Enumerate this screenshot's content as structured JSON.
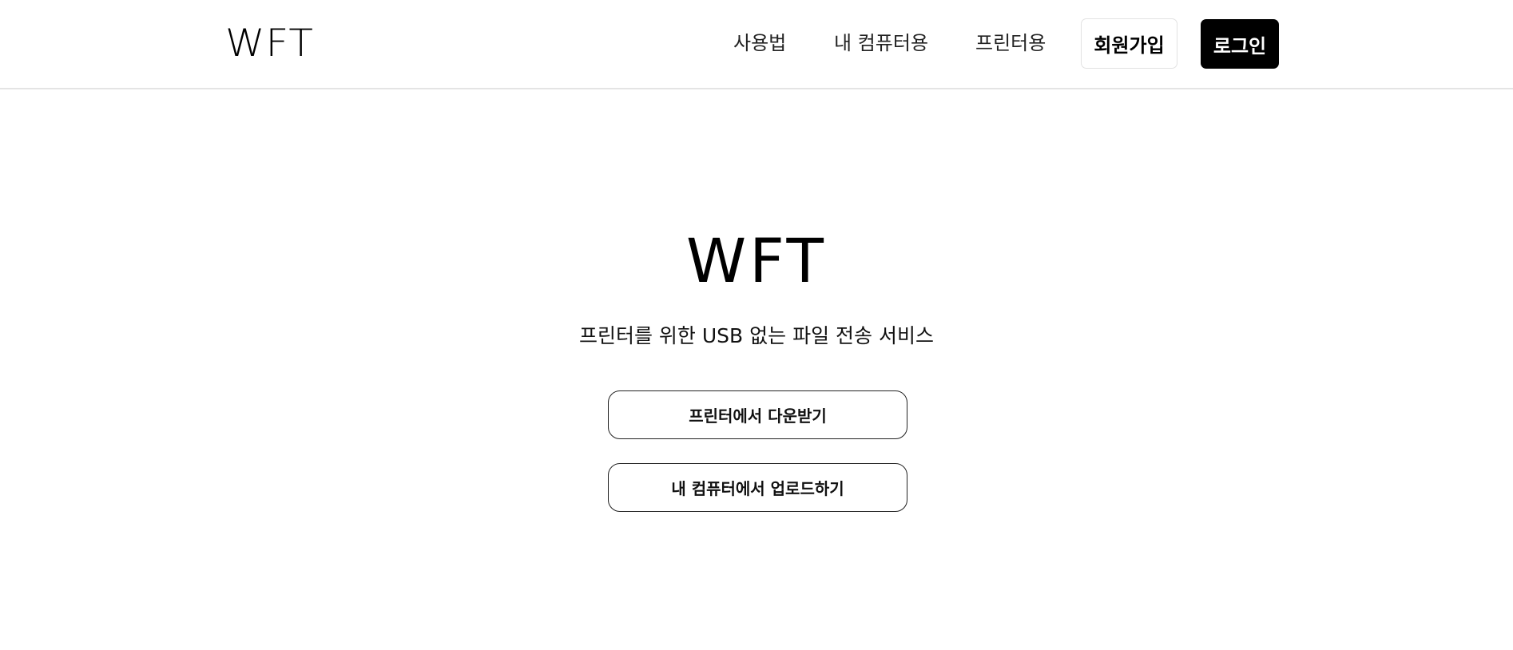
{
  "header": {
    "logo": "WFT",
    "nav": {
      "how_to": "사용법",
      "my_computer": "내 컴퓨터용",
      "printer": "프린터용"
    },
    "signup_label": "회원가입",
    "login_label": "로그인"
  },
  "hero": {
    "title": "WFT",
    "subtitle": "프린터를 위한 USB 없는 파일 전송 서비스",
    "download_button": "프린터에서 다운받기",
    "upload_button": "내 컴퓨터에서 업로드하기"
  },
  "colors": {
    "background": "#ffffff",
    "text": "#000000",
    "login_bg": "#000000",
    "login_text": "#ffffff",
    "divider": "#e4e4e4"
  }
}
